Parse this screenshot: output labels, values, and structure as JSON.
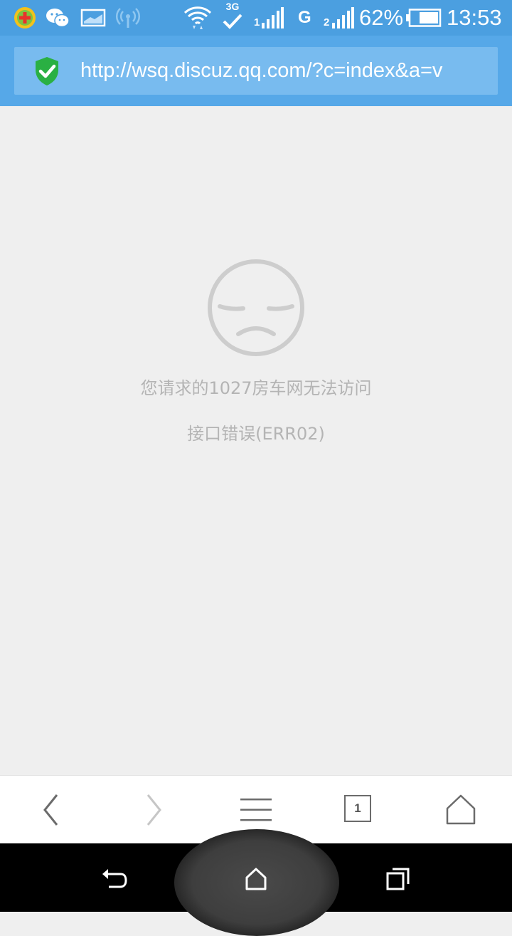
{
  "status_bar": {
    "battery_percent": "62%",
    "time": "13:53",
    "signal_labels": [
      "3G",
      "1",
      "G",
      "2"
    ]
  },
  "browser": {
    "url": "http://wsq.discuz.qq.com/?c=index&a=v",
    "tab_count": "1"
  },
  "error": {
    "line1": "您请求的1027房车网无法访问",
    "line2": "接口错误(ERR02)"
  },
  "colors": {
    "status_bar": "#4b9fe0",
    "address_bar": "#56a8e8",
    "address_box": "#78bbef",
    "content_bg": "#efefef",
    "shield_green": "#2ab043",
    "error_text": "#b4b4b4"
  },
  "icons": {
    "status": [
      "360-security-icon",
      "wechat-icon",
      "screenshot-icon",
      "hotspot-icon",
      "wifi-icon",
      "3g-check-icon",
      "signal-1-icon",
      "g-signal-icon",
      "signal-2-icon",
      "battery-icon"
    ],
    "toolbar": [
      "back-icon",
      "forward-icon",
      "menu-icon",
      "tabs-icon",
      "home-icon"
    ],
    "navbar": [
      "android-back-icon",
      "android-home-icon",
      "android-recents-icon"
    ]
  }
}
